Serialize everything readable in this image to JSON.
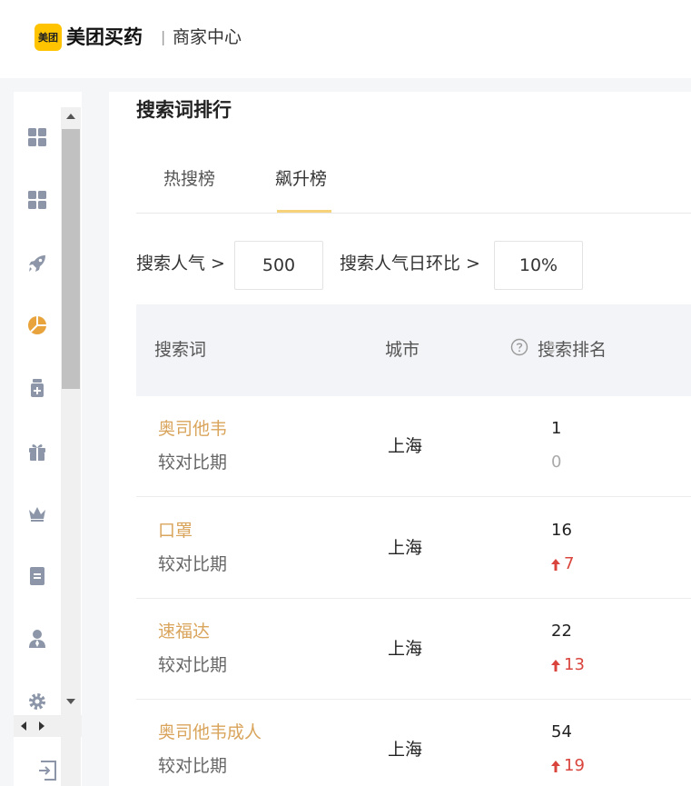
{
  "header": {
    "logo_badge": "美团",
    "brand": "美团买药",
    "separator": "|",
    "subtitle": "商家中心"
  },
  "sidebar": {
    "icons": [
      "dashboard-icon",
      "dashboard-alt-icon",
      "rocket-icon",
      "pie-chart-icon",
      "medicine-bottle-icon",
      "gift-icon",
      "crown-icon",
      "document-icon",
      "user-icon",
      "settings-icon"
    ],
    "active_color": "#e8a33d",
    "icon_color": "#8c96a8"
  },
  "main": {
    "section_title": "搜索词排行",
    "tabs": [
      {
        "label": "热搜榜",
        "active": false
      },
      {
        "label": "飙升榜",
        "active": true
      }
    ],
    "filters": {
      "popularity_label": "搜索人气 >",
      "popularity_value": "500",
      "daily_ratio_label": "搜索人气日环比 >",
      "daily_ratio_value": "10%"
    },
    "table": {
      "headers": {
        "keyword": "搜索词",
        "city": "城市",
        "rank": "搜索排名"
      },
      "rows": [
        {
          "keyword": "奥司他韦",
          "compare": "较对比期",
          "city": "上海",
          "rank": "1",
          "delta": "0",
          "trend": "flat"
        },
        {
          "keyword": "口罩",
          "compare": "较对比期",
          "city": "上海",
          "rank": "16",
          "delta": "7",
          "trend": "up"
        },
        {
          "keyword": "速福达",
          "compare": "较对比期",
          "city": "上海",
          "rank": "22",
          "delta": "13",
          "trend": "up"
        },
        {
          "keyword": "奥司他韦成人",
          "compare": "较对比期",
          "city": "上海",
          "rank": "54",
          "delta": "19",
          "trend": "up"
        }
      ]
    }
  },
  "colors": {
    "accent": "#ffc300",
    "keyword": "#d9a45b",
    "up": "#d9453d"
  }
}
